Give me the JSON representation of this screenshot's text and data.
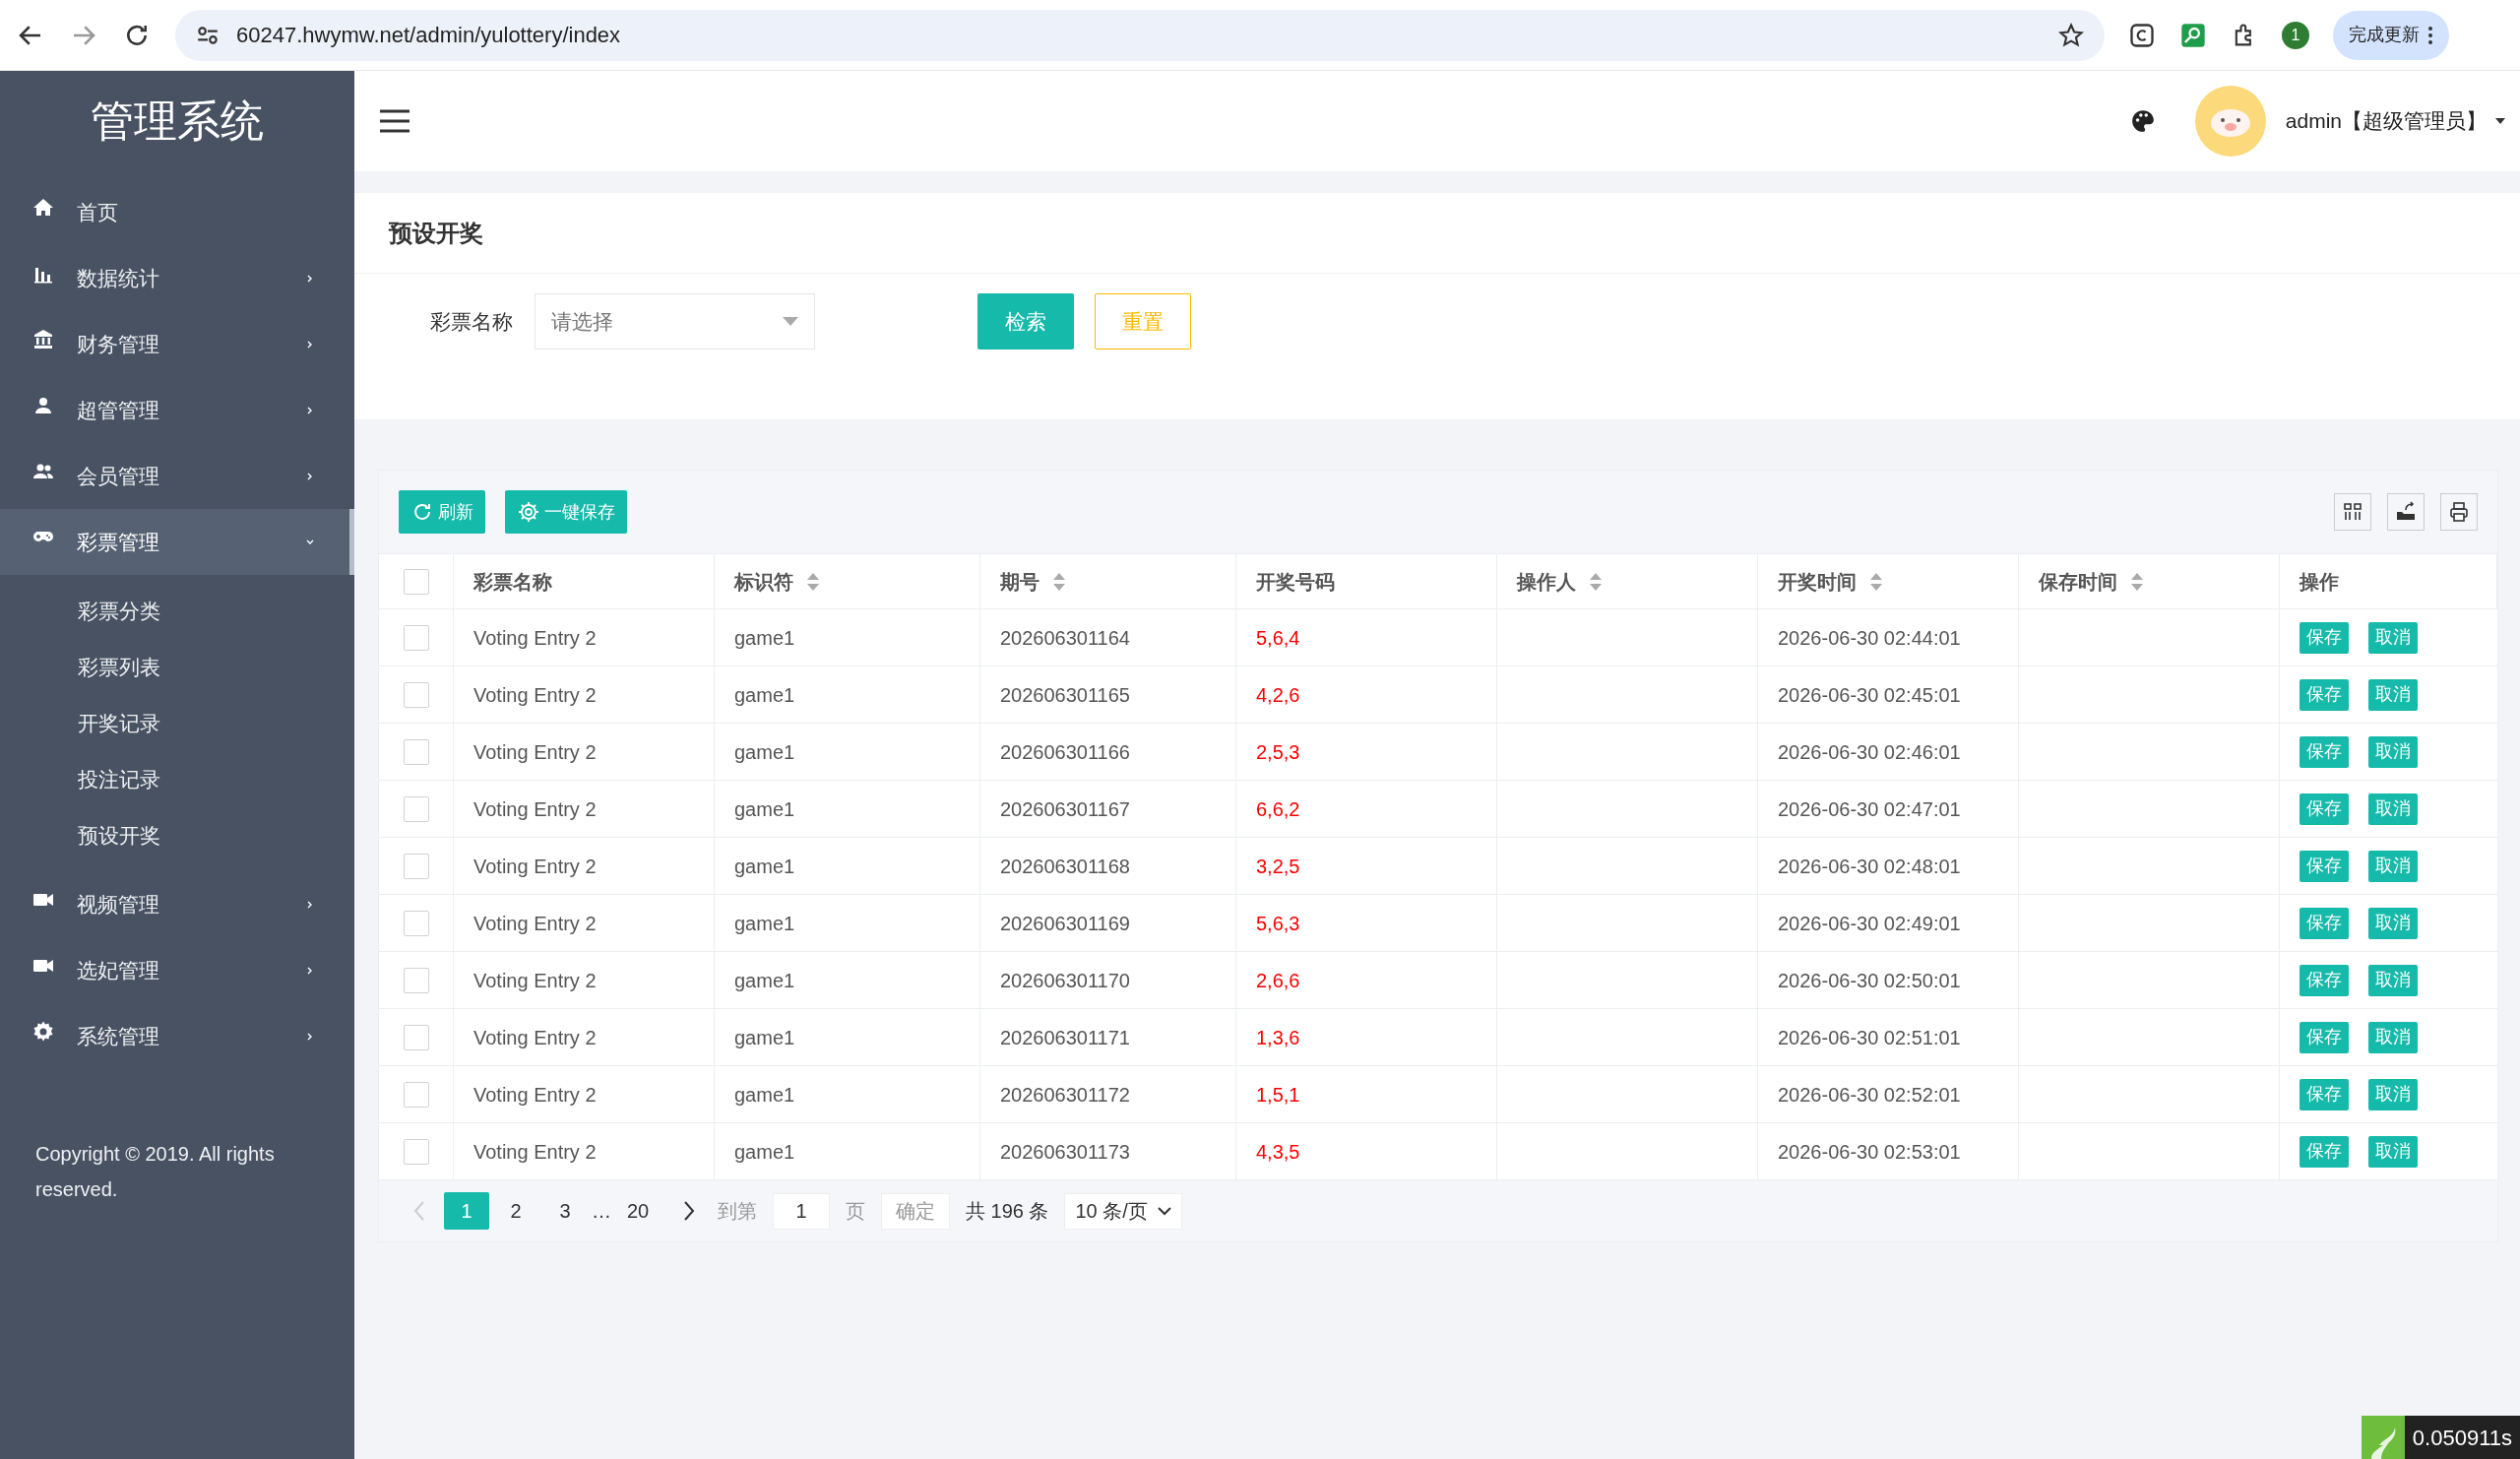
{
  "browser": {
    "url": "60247.hwymw.net/admin/yulottery/index",
    "profile": "1",
    "update_button": "完成更新"
  },
  "sidebar": {
    "title": "管理系统",
    "items": [
      {
        "label": "首页",
        "kind": "link",
        "selected": false
      },
      {
        "label": "数据统计",
        "kind": "submenu",
        "selected": false,
        "expanded": false
      },
      {
        "label": "财务管理",
        "kind": "submenu",
        "selected": false,
        "expanded": false
      },
      {
        "label": "超管管理",
        "kind": "submenu",
        "selected": false,
        "expanded": false
      },
      {
        "label": "会员管理",
        "kind": "submenu",
        "selected": false,
        "expanded": false
      },
      {
        "label": "彩票管理",
        "kind": "submenu",
        "selected": true,
        "expanded": true,
        "children": [
          {
            "label": "彩票分类",
            "selected": false
          },
          {
            "label": "彩票列表",
            "selected": false
          },
          {
            "label": "开奖记录",
            "selected": false
          },
          {
            "label": "投注记录",
            "selected": false
          },
          {
            "label": "预设开奖",
            "selected": false
          }
        ]
      },
      {
        "label": "视频管理",
        "kind": "submenu",
        "selected": false,
        "expanded": false
      },
      {
        "label": "选妃管理",
        "kind": "submenu",
        "selected": false,
        "expanded": false
      },
      {
        "label": "系统管理",
        "kind": "submenu",
        "selected": false,
        "expanded": false
      }
    ],
    "copyright": "Copyright © 2019. All rights reserved."
  },
  "header": {
    "user": "admin【超级管理员】"
  },
  "page": {
    "title": "预设开奖",
    "filter": {
      "label": "彩票名称",
      "placeholder": "请选择"
    },
    "search_button": "检索",
    "reset_button": "重置"
  },
  "table": {
    "select_all_checked": false,
    "toolbar": [
      "刷新",
      "一键保存"
    ],
    "columns": [
      {
        "label": "彩票名称",
        "sortable": false
      },
      {
        "label": "标识符",
        "sortable": true
      },
      {
        "label": "期号",
        "sortable": true
      },
      {
        "label": "开奖号码",
        "sortable": false
      },
      {
        "label": "操作人",
        "sortable": true
      },
      {
        "label": "开奖时间",
        "sortable": true
      },
      {
        "label": "保存时间",
        "sortable": true
      },
      {
        "label": "操作",
        "sortable": false
      }
    ],
    "rows": [
      {
        "checked": false,
        "name": "Voting Entry 2",
        "id": "game1",
        "period": "202606301164",
        "numbers": "5,6,4",
        "open_time": "2026-06-30 02:44:01",
        "actions": [
          "保存",
          "取消"
        ]
      },
      {
        "checked": false,
        "name": "Voting Entry 2",
        "id": "game1",
        "period": "202606301165",
        "numbers": "4,2,6",
        "open_time": "2026-06-30 02:45:01",
        "actions": [
          "保存",
          "取消"
        ]
      },
      {
        "checked": false,
        "name": "Voting Entry 2",
        "id": "game1",
        "period": "202606301166",
        "numbers": "2,5,3",
        "open_time": "2026-06-30 02:46:01",
        "actions": [
          "保存",
          "取消"
        ]
      },
      {
        "checked": false,
        "name": "Voting Entry 2",
        "id": "game1",
        "period": "202606301167",
        "numbers": "6,6,2",
        "open_time": "2026-06-30 02:47:01",
        "actions": [
          "保存",
          "取消"
        ]
      },
      {
        "checked": false,
        "name": "Voting Entry 2",
        "id": "game1",
        "period": "202606301168",
        "numbers": "3,2,5",
        "open_time": "2026-06-30 02:48:01",
        "actions": [
          "保存",
          "取消"
        ]
      },
      {
        "checked": false,
        "name": "Voting Entry 2",
        "id": "game1",
        "period": "202606301169",
        "numbers": "5,6,3",
        "open_time": "2026-06-30 02:49:01",
        "actions": [
          "保存",
          "取消"
        ]
      },
      {
        "checked": false,
        "name": "Voting Entry 2",
        "id": "game1",
        "period": "202606301170",
        "numbers": "2,6,6",
        "open_time": "2026-06-30 02:50:01",
        "actions": [
          "保存",
          "取消"
        ]
      },
      {
        "checked": false,
        "name": "Voting Entry 2",
        "id": "game1",
        "period": "202606301171",
        "numbers": "1,3,6",
        "open_time": "2026-06-30 02:51:01",
        "actions": [
          "保存",
          "取消"
        ]
      },
      {
        "checked": false,
        "name": "Voting Entry 2",
        "id": "game1",
        "period": "202606301172",
        "numbers": "1,5,1",
        "open_time": "2026-06-30 02:52:01",
        "actions": [
          "保存",
          "取消"
        ]
      },
      {
        "checked": false,
        "name": "Voting Entry 2",
        "id": "game1",
        "period": "202606301173",
        "numbers": "4,3,5",
        "open_time": "2026-06-30 02:53:01",
        "actions": [
          "保存",
          "取消"
        ]
      }
    ]
  },
  "pagination": {
    "pages": [
      {
        "label": "1",
        "selected": true
      },
      {
        "label": "2",
        "selected": false
      },
      {
        "label": "3",
        "selected": false
      }
    ],
    "ellipsis": "…",
    "last_page": "20",
    "goto_label": "到第",
    "goto_value": "1",
    "page_unit": "页",
    "confirm": "确定",
    "total": "共 196 条",
    "page_size": "10 条/页"
  },
  "timer": "0.050911s"
}
